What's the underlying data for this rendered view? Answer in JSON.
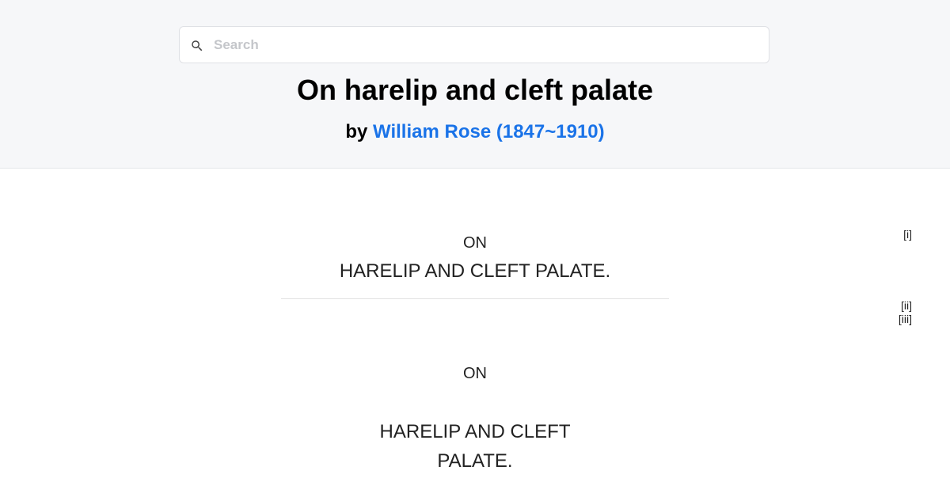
{
  "search": {
    "placeholder": "Search",
    "icon": "search-icon"
  },
  "book": {
    "title": "On harelip and cleft palate",
    "by_label": "by",
    "author": "William Rose (1847~1910)"
  },
  "content": {
    "half_title_on": "ON",
    "half_title": "HARELIP AND CLEFT PALATE.",
    "title_page_on": "ON",
    "title_line_1": "HARELIP AND CLEFT",
    "title_line_2": "PALATE."
  },
  "page_markers": [
    "[i]",
    "[ii]",
    "[iii]"
  ]
}
